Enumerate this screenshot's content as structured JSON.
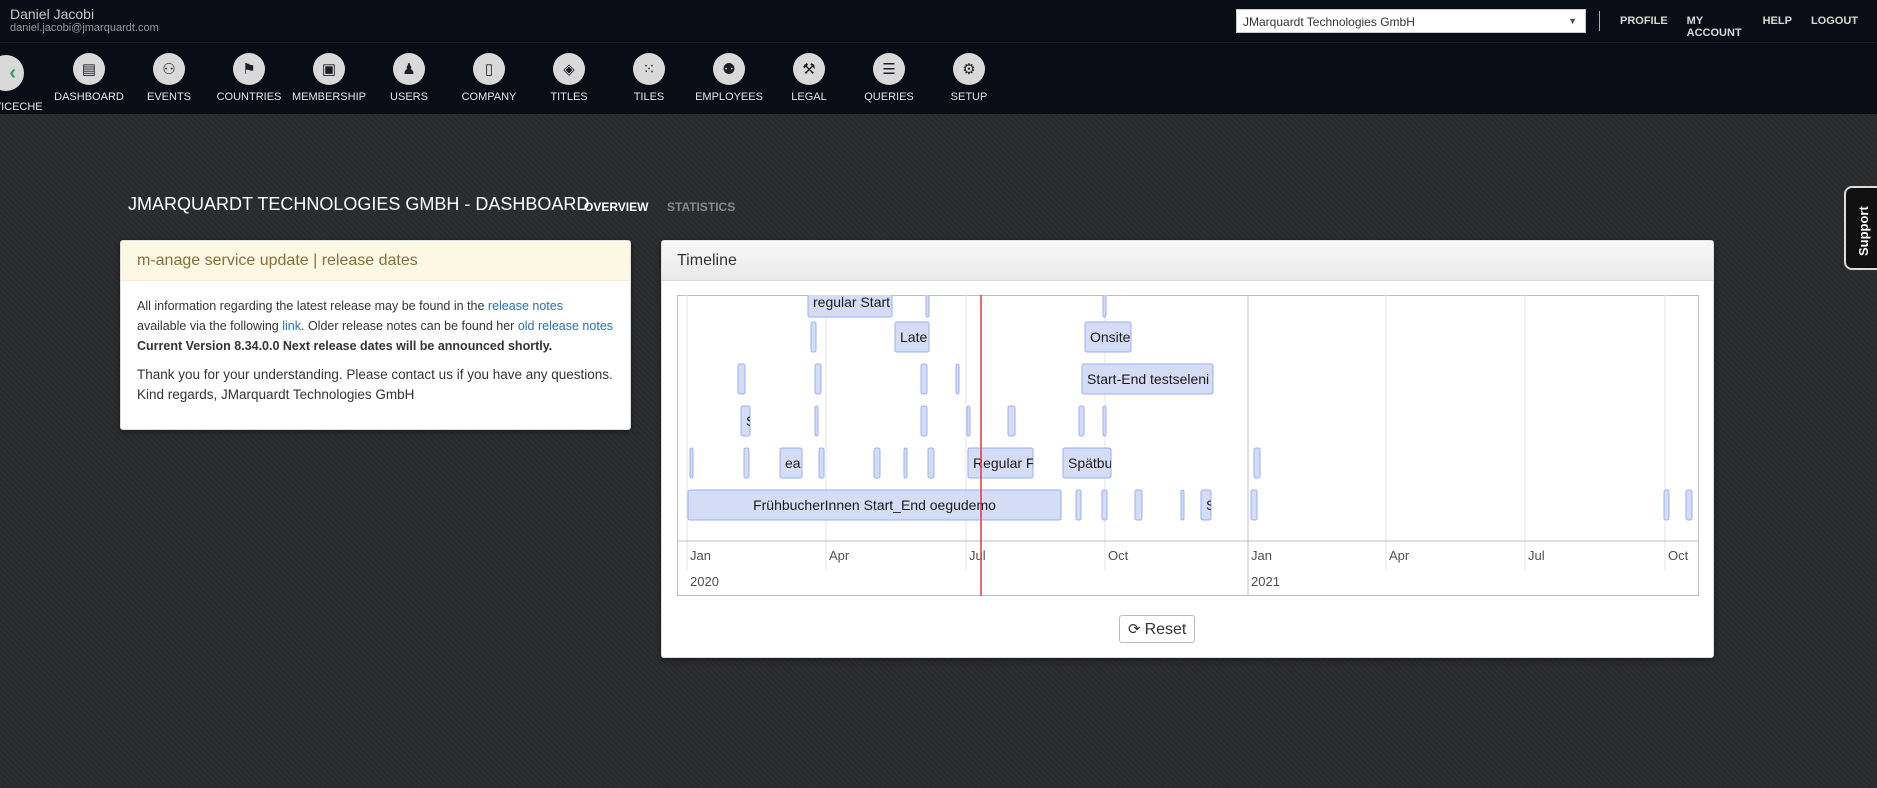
{
  "user": {
    "name": "Daniel Jacobi",
    "email": "daniel.jacobi@jmarquardt.com"
  },
  "company_select": {
    "value": "JMarquardt Technologies GmbH"
  },
  "top_links": [
    "PROFILE",
    "MY ACCOUNT",
    "HELP",
    "LOGOUT"
  ],
  "nav": {
    "back_label": "RVICECHE",
    "items": [
      {
        "label": "DASHBOARD",
        "icon": "dashboard-icon",
        "glyph": "▤"
      },
      {
        "label": "EVENTS",
        "icon": "events-icon",
        "glyph": "⚇"
      },
      {
        "label": "COUNTRIES",
        "icon": "flag-icon",
        "glyph": "⚑"
      },
      {
        "label": "MEMBERSHIP",
        "icon": "id-card-icon",
        "glyph": "▣"
      },
      {
        "label": "USERS",
        "icon": "user-icon",
        "glyph": "♟"
      },
      {
        "label": "COMPANY",
        "icon": "building-icon",
        "glyph": "▯"
      },
      {
        "label": "TITLES",
        "icon": "graduation-cap-icon",
        "glyph": "◈"
      },
      {
        "label": "TILES",
        "icon": "grid-icon",
        "glyph": "⁙"
      },
      {
        "label": "EMPLOYEES",
        "icon": "people-icon",
        "glyph": "⚉"
      },
      {
        "label": "LEGAL",
        "icon": "gavel-icon",
        "glyph": "⚒"
      },
      {
        "label": "QUERIES",
        "icon": "list-icon",
        "glyph": "☰"
      },
      {
        "label": "SETUP",
        "icon": "gear-icon",
        "glyph": "⚙"
      }
    ]
  },
  "page": {
    "title": "JMARQUARDT TECHNOLOGIES GMBH - DASHBOARD",
    "tabs": [
      "OVERVIEW",
      "STATISTICS"
    ]
  },
  "support_label": "Support",
  "info_panel": {
    "heading": "m-anage service update | release dates",
    "p1_a": "All information regarding the latest release may be found in the ",
    "p1_link1": "release notes",
    "p1_b": " available via the following ",
    "p1_link2": "link",
    "p1_c": ". Older release notes can be found her ",
    "p1_link3": "old release notes",
    "p1_bold": " Current Version 8.34.0.0 Next release dates will be announced shortly.",
    "p2": "Thank you for your understanding. Please contact us if you have any questions. Kind regards, JMarquardt Technologies GmbH"
  },
  "timeline": {
    "heading": "Timeline",
    "reset_label": "Reset",
    "month_labels": [
      "Jan",
      "Apr",
      "Jul",
      "Oct",
      "Jan",
      "Apr",
      "Jul",
      "Oct"
    ],
    "year_labels": [
      "2020",
      "2021"
    ],
    "item_labels": [
      "regular Start",
      "Late",
      "Onsite",
      "Start-End testseleni",
      "S",
      "ea",
      "Regular F",
      "Spätbu",
      "FrühbucherInnen Start_End oegudemo",
      "S"
    ]
  },
  "colors": {
    "item_fill": "#d5ddf6",
    "item_border": "#97b0f8",
    "current_time": "#e03a3a",
    "nav_bg": "#0a0d16"
  }
}
